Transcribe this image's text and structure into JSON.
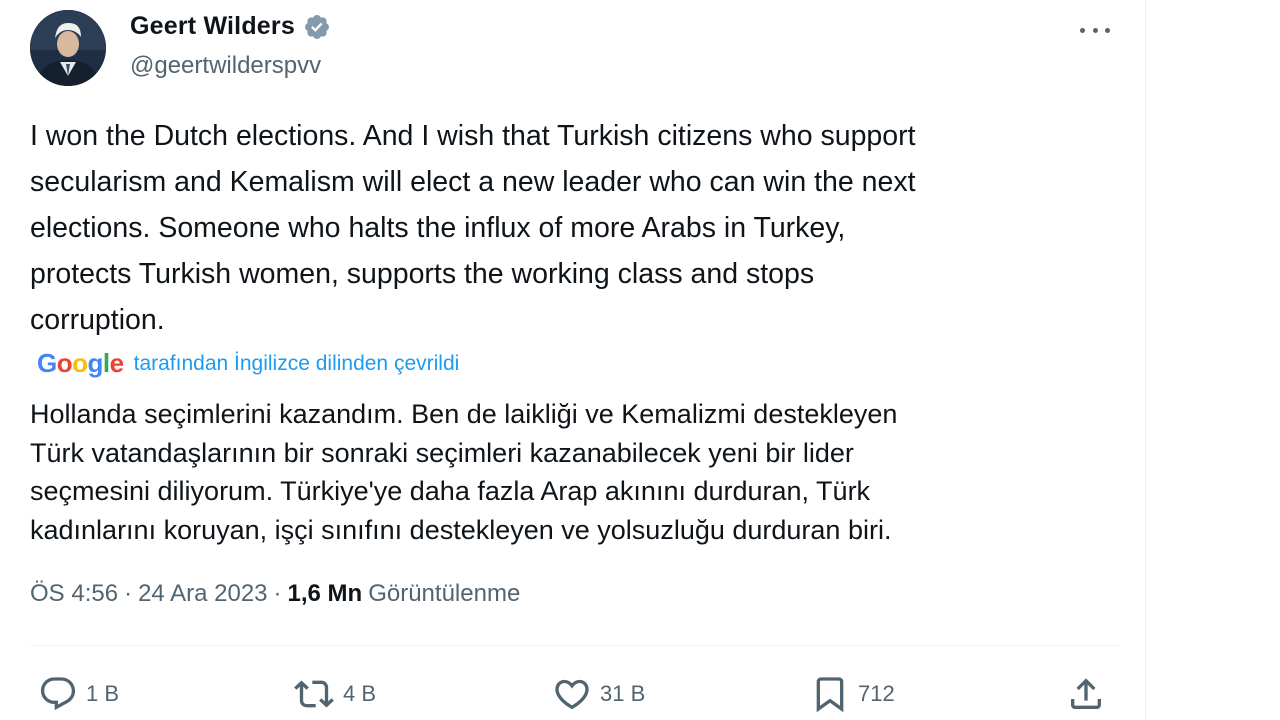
{
  "author": {
    "display_name": "Geert Wilders",
    "handle": "@geertwilderspvv",
    "verified": true
  },
  "tweet": {
    "text_original": "I won the Dutch elections. And I wish that Turkish citizens who support\nsecularism and Kemalism will elect a new leader who can win the next\nelections. Someone who halts the influx of more Arabs in Turkey,\nprotects Turkish women, supports the working class and stops\ncorruption.",
    "translation_provider": "Google",
    "translation_note": "tarafından İngilizce dilinden çevrildi",
    "text_translated": "Hollanda seçimlerini kazandım. Ben de laikliği ve Kemalizmi destekleyen\nTürk vatandaşlarının bir sonraki seçimleri kazanabilecek yeni bir lider\nseçmesini diliyorum. Türkiye'ye daha fazla Arap akınını durduran, Türk\nkadınlarını koruyan, işçi sınıfını destekleyen ve yolsuzluğu durduran biri."
  },
  "meta": {
    "time": "ÖS 4:56",
    "date": "24 Ara 2023",
    "separator": "·",
    "views_count": "1,6 Mn",
    "views_label": "Görüntülenme"
  },
  "actions": {
    "replies": "1 B",
    "reposts": "4 B",
    "likes": "31 B",
    "bookmarks": "712"
  },
  "colors": {
    "text_primary": "#0f1419",
    "text_secondary": "#536471",
    "accent": "#1d9bf0",
    "verified_badge": "#829aab",
    "divider": "#eff3f4"
  },
  "icons": {
    "verified": "verified-badge-icon",
    "more": "more-options-icon",
    "reply": "reply-icon",
    "repost": "repost-icon",
    "like": "heart-icon",
    "bookmark": "bookmark-icon",
    "share": "share-icon"
  }
}
